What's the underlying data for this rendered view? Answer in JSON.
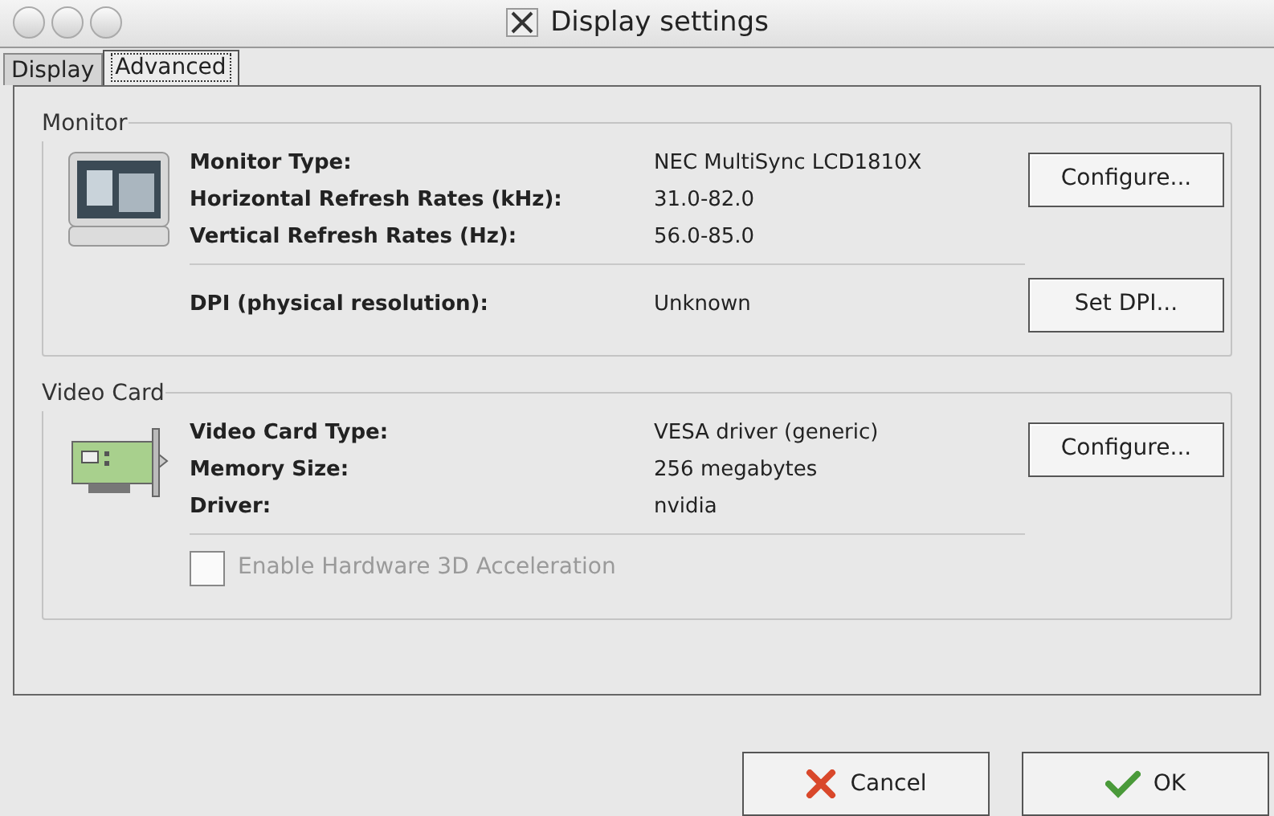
{
  "window": {
    "title": "Display settings"
  },
  "tabs": [
    {
      "label": "Display",
      "selected": false
    },
    {
      "label": "Advanced",
      "selected": true
    }
  ],
  "groups": [
    {
      "title": "Monitor",
      "kind": "monitor",
      "rows": [
        {
          "label": "Monitor Type:",
          "value": "NEC MultiSync LCD1810X"
        },
        {
          "label": "Horizontal Refresh Rates (kHz):",
          "value": "31.0-82.0"
        },
        {
          "label": "Vertical Refresh Rates (Hz):",
          "value": "56.0-85.0"
        }
      ],
      "button": "Configure...",
      "extra": {
        "kind": "row",
        "label": "DPI (physical resolution):",
        "value": "Unknown",
        "button": "Set DPI..."
      }
    },
    {
      "title": "Video Card",
      "kind": "card",
      "rows": [
        {
          "label": "Video Card Type:",
          "value": "VESA driver (generic)"
        },
        {
          "label": "Memory Size:",
          "value": "256 megabytes"
        },
        {
          "label": "Driver:",
          "value": "nvidia"
        }
      ],
      "button": "Configure...",
      "extra": {
        "kind": "checkbox",
        "label": "Enable Hardware 3D Acceleration",
        "checked": false,
        "disabled": true
      }
    }
  ],
  "buttons": [
    {
      "label": "Cancel",
      "kind": "cancel"
    },
    {
      "label": "OK",
      "kind": "ok"
    }
  ]
}
